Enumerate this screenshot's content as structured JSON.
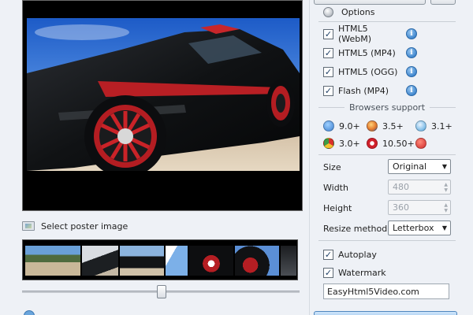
{
  "preview": {
    "poster_label": "Select poster image"
  },
  "options": {
    "title": "Options",
    "formats": [
      {
        "label": "HTML5 (WebM)",
        "checked": true,
        "info_icon": "info-icon"
      },
      {
        "label": "HTML5 (MP4)",
        "checked": true,
        "info_icon": "info-icon"
      },
      {
        "label": "HTML5 (OGG)",
        "checked": true,
        "info_icon": "info-icon"
      },
      {
        "label": "Flash (MP4)",
        "checked": true,
        "info_icon": "info-icon"
      }
    ]
  },
  "browsers": {
    "title": "Browsers support",
    "items": [
      {
        "icon": "ie-icon",
        "version": "9.0+",
        "color": "#3c7fd0"
      },
      {
        "icon": "firefox-icon",
        "version": "3.5+",
        "color": "#e2762a"
      },
      {
        "icon": "safari-icon",
        "version": "3.1+",
        "color": "#4fa3dc"
      },
      {
        "icon": "chrome-icon",
        "version": "3.0+",
        "color": "#d9a531"
      },
      {
        "icon": "opera-icon",
        "version": "10.50+",
        "color": "#d0202a"
      },
      {
        "icon": "blocked-icon",
        "version": "",
        "color": "#cf2a2a"
      }
    ]
  },
  "settings": {
    "size_label": "Size",
    "size_value": "Original",
    "width_label": "Width",
    "width_value": "480",
    "height_label": "Height",
    "height_value": "360",
    "resize_label": "Resize method",
    "resize_value": "Letterbox",
    "autoplay_label": "Autoplay",
    "autoplay_checked": true,
    "watermark_label": "Watermark",
    "watermark_checked": true,
    "watermark_text": "EasyHtml5Video.com"
  },
  "check_mark": "✓",
  "info_glyph": "i",
  "arrow_glyph": "▼",
  "spin_up": "▲",
  "spin_down": "▼"
}
